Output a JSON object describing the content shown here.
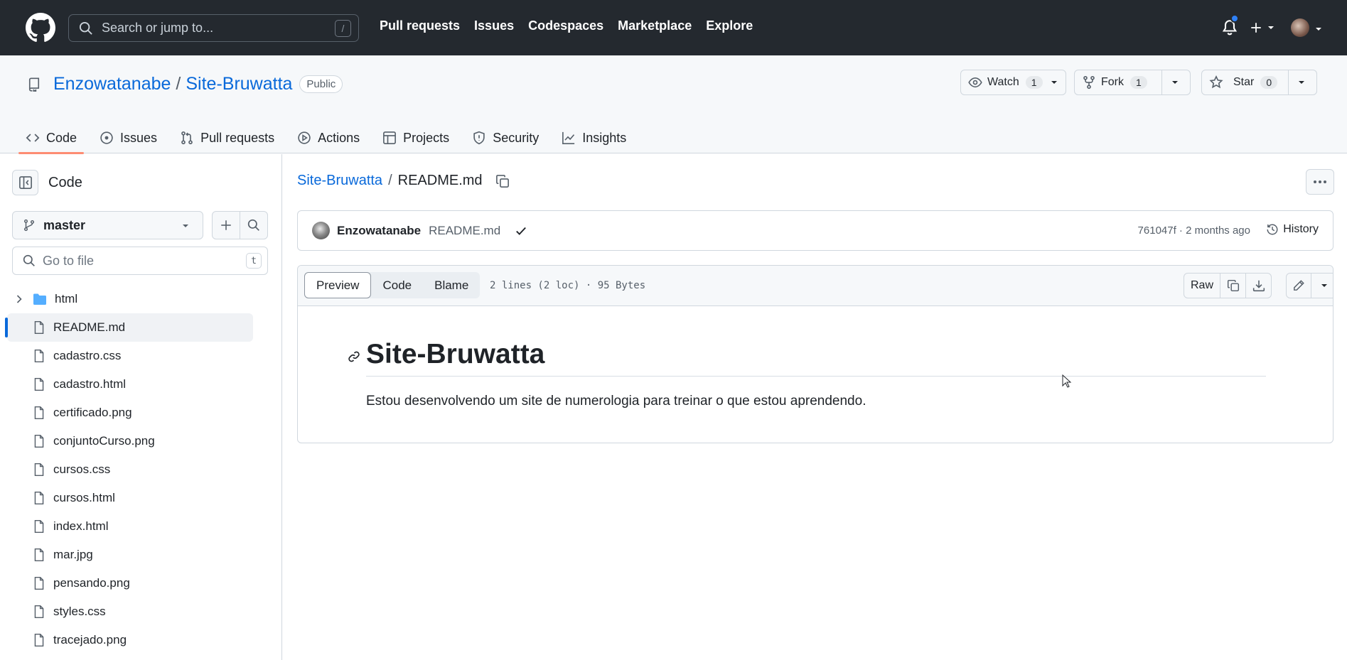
{
  "header": {
    "search_placeholder": "Search or jump to...",
    "search_shortcut": "/",
    "nav": [
      "Pull requests",
      "Issues",
      "Codespaces",
      "Marketplace",
      "Explore"
    ]
  },
  "repo": {
    "owner": "Enzowatanabe",
    "separator": "/",
    "name": "Site-Bruwatta",
    "visibility": "Public",
    "watch_label": "Watch",
    "watch_count": "1",
    "fork_label": "Fork",
    "fork_count": "1",
    "star_label": "Star",
    "star_count": "0",
    "tabs": [
      {
        "label": "Code",
        "icon": "code-icon",
        "active": true
      },
      {
        "label": "Issues",
        "icon": "issue-icon"
      },
      {
        "label": "Pull requests",
        "icon": "pull-request-icon"
      },
      {
        "label": "Actions",
        "icon": "play-icon"
      },
      {
        "label": "Projects",
        "icon": "table-icon"
      },
      {
        "label": "Security",
        "icon": "shield-icon"
      },
      {
        "label": "Insights",
        "icon": "graph-icon"
      }
    ]
  },
  "sidebar": {
    "title": "Code",
    "branch": "master",
    "goto_placeholder": "Go to file",
    "goto_shortcut": "t",
    "files": [
      {
        "name": "html",
        "type": "folder"
      },
      {
        "name": "README.md",
        "type": "file",
        "selected": true
      },
      {
        "name": "cadastro.css",
        "type": "file"
      },
      {
        "name": "cadastro.html",
        "type": "file"
      },
      {
        "name": "certificado.png",
        "type": "file"
      },
      {
        "name": "conjuntoCurso.png",
        "type": "file"
      },
      {
        "name": "cursos.css",
        "type": "file"
      },
      {
        "name": "cursos.html",
        "type": "file"
      },
      {
        "name": "index.html",
        "type": "file"
      },
      {
        "name": "mar.jpg",
        "type": "file"
      },
      {
        "name": "pensando.png",
        "type": "file"
      },
      {
        "name": "styles.css",
        "type": "file"
      },
      {
        "name": "tracejado.png",
        "type": "file"
      }
    ]
  },
  "main": {
    "crumb_repo": "Site-Bruwatta",
    "crumb_sep": "/",
    "crumb_file": "README.md",
    "commit": {
      "author": "Enzowatanabe",
      "message": "README.md",
      "meta": "761047f · 2 months ago",
      "history_label": "History"
    },
    "file": {
      "views": [
        "Preview",
        "Code",
        "Blame"
      ],
      "info": "2 lines (2 loc) · 95 Bytes",
      "raw_label": "Raw"
    },
    "readme": {
      "heading": "Site-Bruwatta",
      "paragraph": "Estou desenvolvendo um site de numerologia para treinar o que estou aprendendo."
    }
  },
  "colors": {
    "header_bg": "#24292f",
    "link": "#0969da",
    "tab_underline": "#fd8c73",
    "notification_dot": "#2f81f7"
  }
}
